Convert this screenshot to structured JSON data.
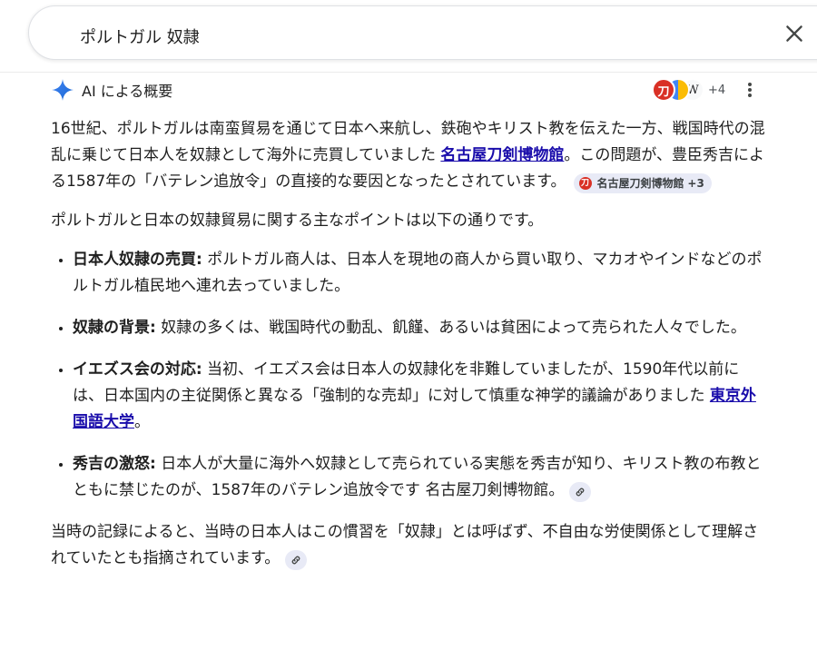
{
  "search": {
    "query": "ポルトガル 奴隷"
  },
  "ai_overview": {
    "title": "AI による概要",
    "sources_more": "+4",
    "paragraph1": {
      "text_a": "16世紀、ポルトガルは南蛮貿易を通じて日本へ来航し、鉄砲やキリスト教を伝えた一方、戦国時代の混乱に乗じて日本人を奴隷として海外に売買していました ",
      "link": "名古屋刀剣博物館",
      "text_b": "。この問題が、豊臣秀吉による1587年の「バテレン追放令」の直接的な要因となったとされています。",
      "chip_label": "名古屋刀剣博物館",
      "chip_count": "+3"
    },
    "intro": "ポルトガルと日本の奴隷貿易に関する主なポイントは以下の通りです。",
    "points": [
      {
        "title": "日本人奴隷の売買:",
        "text": " ポルトガル商人は、日本人を現地の商人から買い取り、マカオやインドなどのポルトガル植民地へ連れ去っていました。"
      },
      {
        "title": "奴隷の背景:",
        "text": " 奴隷の多くは、戦国時代の動乱、飢饉、あるいは貧困によって売られた人々でした。"
      },
      {
        "title": "イエズス会の対応:",
        "text": " 当初、イエズス会は日本人の奴隷化を非難していましたが、1590年代以前には、日本国内の主従関係と異なる「強制的な売却」に対して慎重な神学的議論がありました ",
        "link": "東京外国語大学",
        "tail": "。"
      },
      {
        "title": "秀吉の激怒:",
        "text": " 日本人が大量に海外へ奴隷として売られている実態を秀吉が知り、キリスト教の布教とともに禁じたのが、1587年のバテレン追放令です 名古屋刀剣博物館。"
      }
    ],
    "closing": "当時の記録によると、当時の日本人はこの慣習を「奴隷」とは呼ばず、不自由な労使関係として理解されていたとも指摘されています。"
  },
  "icons": {
    "close": "close-icon",
    "sparkle": "sparkle-icon",
    "more": "more-vert-icon",
    "link": "link-icon"
  },
  "colors": {
    "link": "#1a0dab",
    "chip_bg": "#e8eaf6",
    "sparkle": "#4285f4"
  }
}
